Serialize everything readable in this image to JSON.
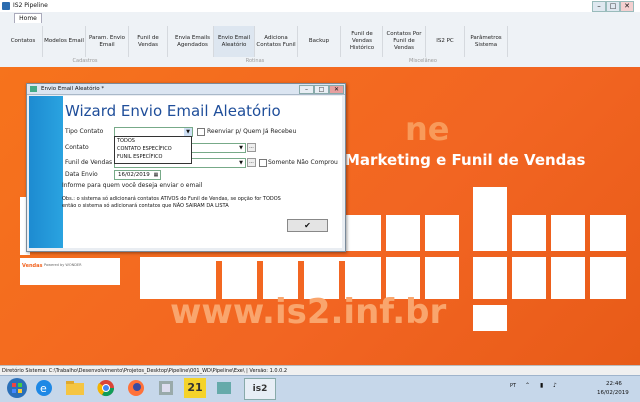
{
  "window": {
    "title": "IS2 Pipeline",
    "min": "–",
    "max": "□",
    "close": "✕"
  },
  "ribbon": {
    "tab": "Home",
    "buttons": [
      {
        "label": "Contatos"
      },
      {
        "label": "Modelos Email"
      },
      {
        "label": "Param. Envio Email"
      },
      {
        "label": "Funil de Vendas"
      },
      {
        "label": "Envia Emails Agendados"
      },
      {
        "label": "Envio Email Aleatório"
      },
      {
        "label": "Adiciona Contatos Funil"
      },
      {
        "label": "Backup"
      },
      {
        "label": "Funil de Vendas Histórico"
      },
      {
        "label": "Contatos Por Funil de Vendas"
      },
      {
        "label": "IS2 PC"
      },
      {
        "label": "Parâmetros Sistema"
      }
    ],
    "groups": [
      "Cadastros",
      "Rotinas",
      "Miscelâneo"
    ]
  },
  "background": {
    "bigline": "ne",
    "tagline": "Marketing e Funil de Vendas",
    "url": "www.is2.inf.br",
    "logo_text": "Vendas",
    "logo_sub": "Powered by WONDER"
  },
  "dialog": {
    "title": "Envio Email Aleatório *",
    "heading": "Wizard Envio Email Aleatório",
    "fields": {
      "tipo_contato": "Tipo Contato",
      "contato": "Contato",
      "funil": "Funil de Vendas",
      "data": "Data Envio",
      "data_value": "16/02/2019"
    },
    "reenviar": "Reenviar p/ Quem Já Recebeu",
    "somente_nao": "Somente Não Comprou",
    "info": "Informe para quem você deseja enviar o email",
    "obs_line1": "Obs.: o sistema só adicionará contatos ATIVOS do Funil de Vendas, se  opção for TODOS",
    "obs_line2": "então o sistema só adicionará contatos que NÃO SAIRAM DA LISTA",
    "dropdown_options": [
      "TODOS",
      "CONTATO ESPECÍFICO",
      "FUNIL ESPECÍFICO"
    ],
    "ok": "✔",
    "ellipsis": "..."
  },
  "status": "Diretório Sistema: C:\\Trabalho\\Desenvolvimento\\Projetos_Desktop\\Pipeline\\001_WD\\Pipeline\\Exe\\ | Versão: 1.0.0.2",
  "taskbar": {
    "apps": [
      "start-icon",
      "ie-icon",
      "explorer-icon",
      "chrome-icon",
      "firefox-icon",
      "tool-icon",
      "windev-icon",
      "app-icon",
      "is2-icon"
    ],
    "badge": "21",
    "is2": "is2",
    "lang": "PT",
    "time": "22:46",
    "date": "16/02/2019"
  },
  "colors": {
    "accent": "#f26522",
    "dialog_blue": "#1f4e9a"
  }
}
